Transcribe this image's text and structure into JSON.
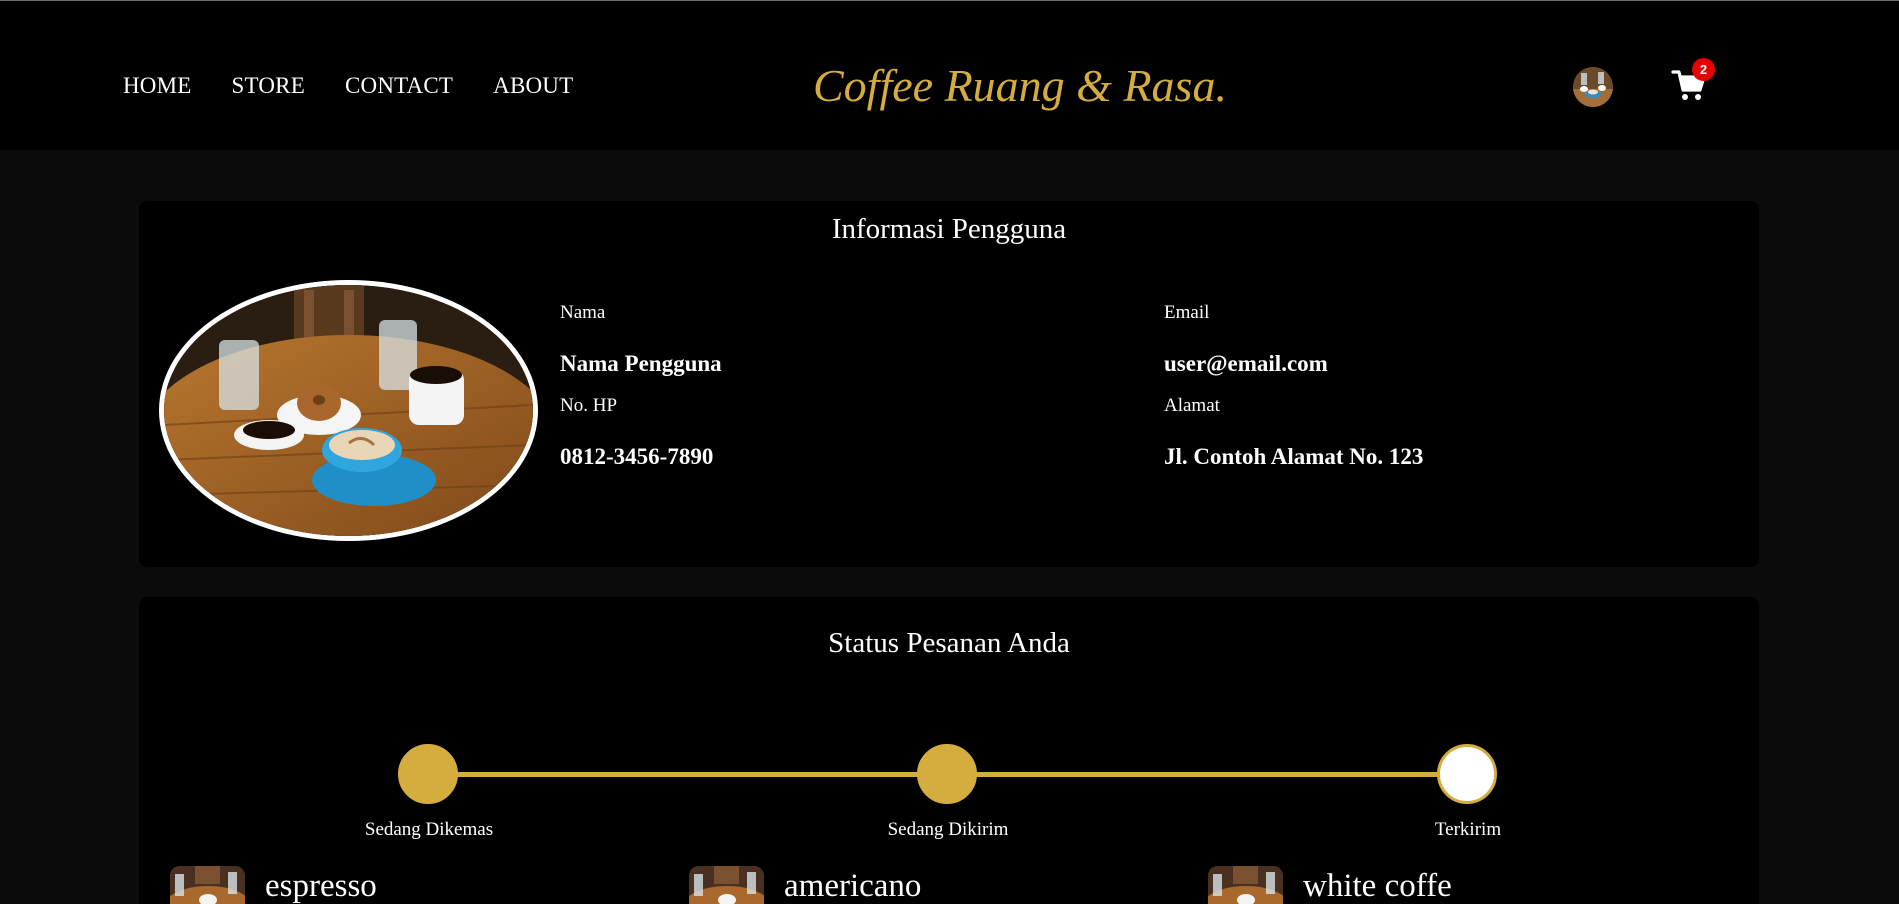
{
  "nav": {
    "items": [
      {
        "label": "HOME"
      },
      {
        "label": "STORE"
      },
      {
        "label": "CONTACT"
      },
      {
        "label": "ABOUT"
      }
    ],
    "brand": "Coffee Ruang & Rasa.",
    "cart_count": "2",
    "icons": {
      "avatar": "user-avatar",
      "cart": "shopping-cart-icon"
    }
  },
  "user_info": {
    "title": "Informasi Pengguna",
    "fields": {
      "name_label": "Nama",
      "name_value": "Nama Pengguna",
      "email_label": "Email",
      "email_value": "user@email.com",
      "phone_label": "No. HP",
      "phone_value": "0812-3456-7890",
      "address_label": "Alamat",
      "address_value": "Jl. Contoh Alamat No. 123"
    }
  },
  "order_status": {
    "title": "Status Pesanan Anda",
    "steps": [
      {
        "label": "Sedang Dikemas",
        "state": "done"
      },
      {
        "label": "Sedang Dikirim",
        "state": "done"
      },
      {
        "label": "Terkirim",
        "state": "pending"
      }
    ],
    "items": [
      {
        "name": "espresso"
      },
      {
        "name": "americano"
      },
      {
        "name": "white coffe"
      }
    ]
  },
  "colors": {
    "accent_gold": "#d5ad3e",
    "badge_red": "#e60000",
    "background": "#0b0b0b",
    "card": "#000000"
  }
}
